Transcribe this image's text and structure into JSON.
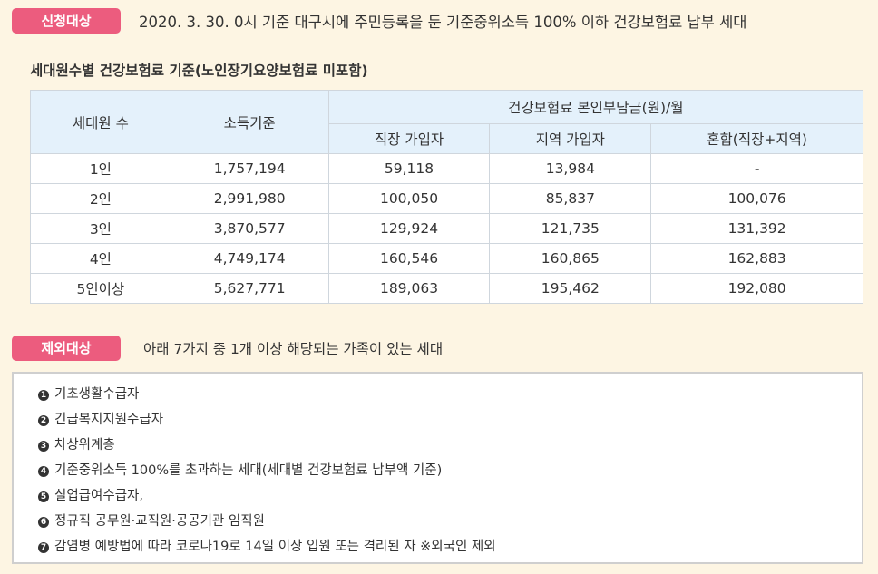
{
  "eligible": {
    "badge": "신청대상",
    "text": "2020. 3. 30. 0시 기준 대구시에 주민등록을 둔 기준중위소득 100% 이하 건강보험료 납부 세대"
  },
  "table_title": "세대원수별 건강보험료 기준(노인장기요양보험료 미포함)",
  "table": {
    "col_household": "세대원 수",
    "col_income": "소득기준",
    "col_premium_group": "건강보험료 본인부담금(원)/월",
    "col_employee": "직장 가입자",
    "col_regional": "지역 가입자",
    "col_mixed": "혼합(직장+지역)",
    "rows": [
      {
        "household": "1인",
        "income": "1,757,194",
        "employee": "59,118",
        "regional": "13,984",
        "mixed": "-"
      },
      {
        "household": "2인",
        "income": "2,991,980",
        "employee": "100,050",
        "regional": "85,837",
        "mixed": "100,076"
      },
      {
        "household": "3인",
        "income": "3,870,577",
        "employee": "129,924",
        "regional": "121,735",
        "mixed": "131,392"
      },
      {
        "household": "4인",
        "income": "4,749,174",
        "employee": "160,546",
        "regional": "160,865",
        "mixed": "162,883"
      },
      {
        "household": "5인이상",
        "income": "5,627,771",
        "employee": "189,063",
        "regional": "195,462",
        "mixed": "192,080"
      }
    ]
  },
  "excluded": {
    "badge": "제외대상",
    "text": "아래 7가지 중 1개 이상 해당되는 가족이 있는 세대",
    "items": [
      {
        "num": "1",
        "text": "기초생활수급자"
      },
      {
        "num": "2",
        "text": "긴급복지지원수급자"
      },
      {
        "num": "3",
        "text": "차상위계층"
      },
      {
        "num": "4",
        "text": "기준중위소득 100%를 초과하는 세대(세대별 건강보험료 납부액 기준)"
      },
      {
        "num": "5",
        "text": "실업급여수급자,"
      },
      {
        "num": "6",
        "text": "정규직 공무원·교직원·공공기관 임직원"
      },
      {
        "num": "7",
        "text": "감염병 예방법에 따라 코로나19로 14일 이상 입원 또는 격리된 자 ※외국인 제외"
      }
    ]
  },
  "colors": {
    "background": "#fdf5e3",
    "badge": "#ec5c7e",
    "table_header": "#e4f1fb"
  }
}
